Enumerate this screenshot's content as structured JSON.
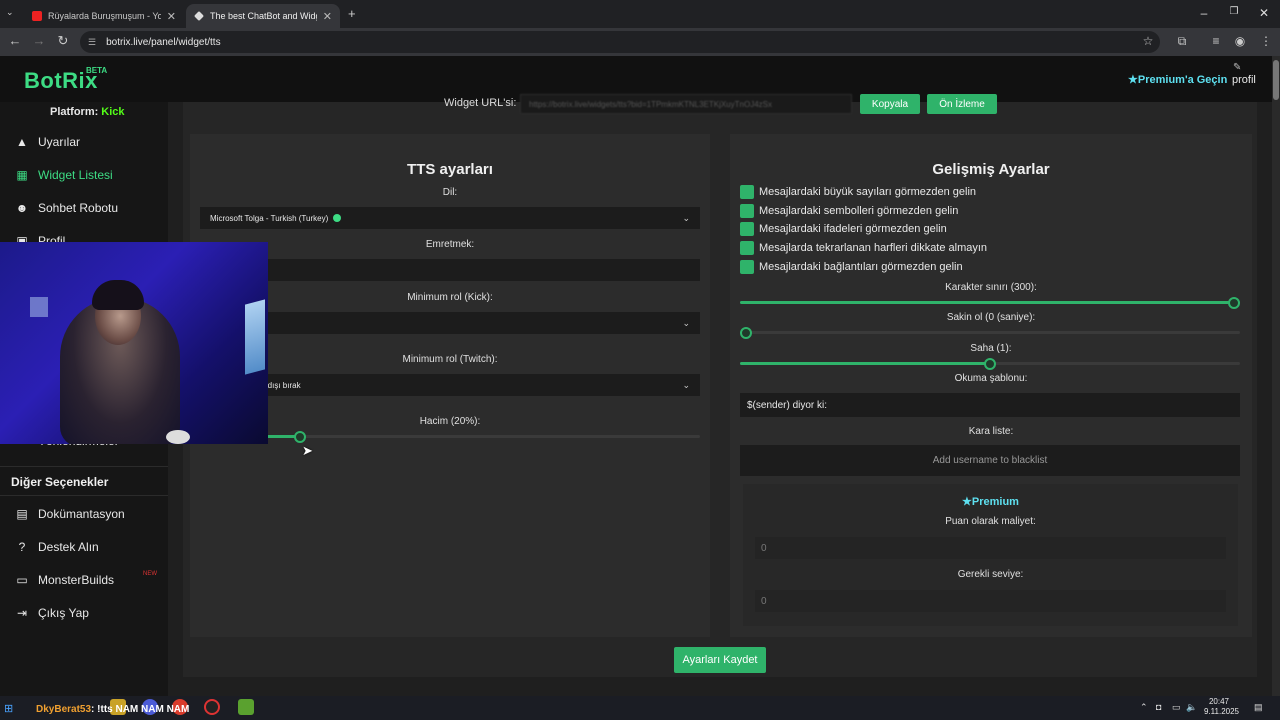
{
  "browser": {
    "tabs": [
      {
        "label": "Rüyalarda Buruşmuşum - YouTube",
        "active": false
      },
      {
        "label": "The best ChatBot and Widgets",
        "active": true
      }
    ],
    "url": "botrix.live/panel/widget/tts",
    "new_tab_symbol": "+"
  },
  "header": {
    "logo": "BotRix",
    "logo_badge": "BETA",
    "premium_link": "Premium'a Geçin",
    "profile": "profil"
  },
  "sidebar": {
    "platform_label": "Platform:",
    "platform_value": "Kick",
    "items": [
      {
        "label": "Uyarılar",
        "icon": "warning-icon"
      },
      {
        "label": "Widget Listesi",
        "icon": "grid-icon",
        "active": true
      },
      {
        "label": "Sohbet Robotu",
        "icon": "robot-icon"
      },
      {
        "label": "Profil",
        "icon": "user-icon"
      },
      {
        "label": "Yönlendirmeler",
        "icon": "redirect-icon"
      }
    ],
    "other_options_title": "Diğer Seçenekler",
    "other_items": [
      {
        "label": "Dokümantasyon",
        "icon": "book-icon"
      },
      {
        "label": "Destek Alın",
        "icon": "help-icon"
      },
      {
        "label": "MonsterBuilds",
        "icon": "laptop-icon",
        "badge": "NEW"
      },
      {
        "label": "Çıkış Yap",
        "icon": "logout-icon"
      }
    ]
  },
  "widget_url": {
    "label": "Widget URL'si:",
    "value": "https://botrix.live/widgets/tts?bid=1TPmkmKTNL3ETKjXuyTnOJ4zSx",
    "copy_button": "Kopyala",
    "preview_button": "Ön İzleme"
  },
  "tts": {
    "title": "TTS ayarları",
    "language_label": "Dil:",
    "language_value": "Microsoft Tolga - Turkish (Turkey)",
    "command_label": "Emretmek:",
    "command_value": "",
    "min_role_kick_label": "Minimum rol (Kick):",
    "min_role_kick_value": "",
    "min_role_twitch_label": "Minimum rol (Twitch):",
    "min_role_twitch_value": "e dışı bırak",
    "volume_label": "Hacim (20%):",
    "volume_value": 0.2
  },
  "advanced": {
    "title": "Gelişmiş Ayarlar",
    "checkboxes": [
      {
        "label": "Mesajlardaki büyük sayıları görmezden gelin",
        "checked": true
      },
      {
        "label": "Mesajlardaki sembolleri görmezden gelin",
        "checked": true
      },
      {
        "label": "Mesajlardaki ifadeleri görmezden gelin",
        "checked": true
      },
      {
        "label": "Mesajlarda tekrarlanan harfleri dikkate almayın",
        "checked": true
      },
      {
        "label": "Mesajlardaki bağlantıları görmezden gelin",
        "checked": true
      }
    ],
    "char_limit_label": "Karakter sınırı (300):",
    "char_limit_value": 1.0,
    "cooldown_label": "Sakin ol (0 (saniye):",
    "cooldown_value": 0.0,
    "pitch_label": "Saha (1):",
    "pitch_value": 0.5,
    "template_label": "Okuma şablonu:",
    "template_value": "$(sender) diyor ki:",
    "blacklist_label": "Kara liste:",
    "blacklist_placeholder": "Add username to blacklist",
    "premium_title": "Premium",
    "cost_label": "Puan olarak maliyet:",
    "cost_value": "0",
    "level_label": "Gerekli seviye:",
    "level_value": "0"
  },
  "save_button": "Ayarları Kaydet",
  "taskbar": {
    "chat_user": "DkyBerat53",
    "chat_message": ": !tts NAM NAM NAM",
    "time": "20:47",
    "date": "9.11.2025"
  },
  "colors": {
    "brand_green": "#3ddc84",
    "button_green": "#2fb36a",
    "premium_cyan": "#5ee0f0",
    "kick_green": "#53fc18"
  }
}
